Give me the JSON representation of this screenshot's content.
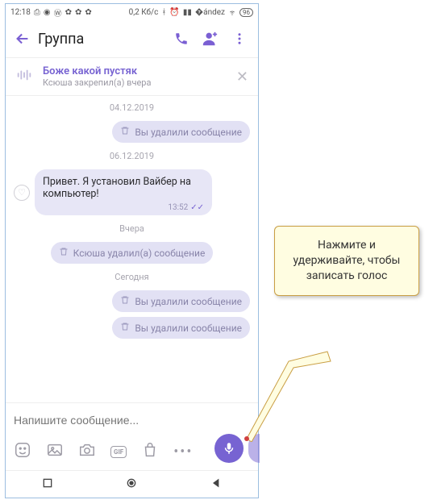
{
  "statusbar": {
    "time": "12:18",
    "net": "0,2 Кб/с",
    "battery": "96"
  },
  "appbar": {
    "title": "Группа"
  },
  "pinned": {
    "title": "Боже какой пустяк",
    "subtitle": "Ксюша закрепил(а) вчера"
  },
  "dates": {
    "d1": "04.12.2019",
    "d2": "06.12.2019",
    "d3": "Вчера",
    "d4": "Сегодня"
  },
  "sys": {
    "youDeleted": "Вы удалили сообщение",
    "ksyushaDeleted": "Ксюша удалил(а) сообщение"
  },
  "msg": {
    "text": "Привет. Я установил Вайбер на компьютер!",
    "time": "13:52"
  },
  "composer": {
    "placeholder": "Напишите сообщение...",
    "gif": "GIF"
  },
  "callout": {
    "text": "Нажмите и удерживайте, чтобы записать голос"
  }
}
